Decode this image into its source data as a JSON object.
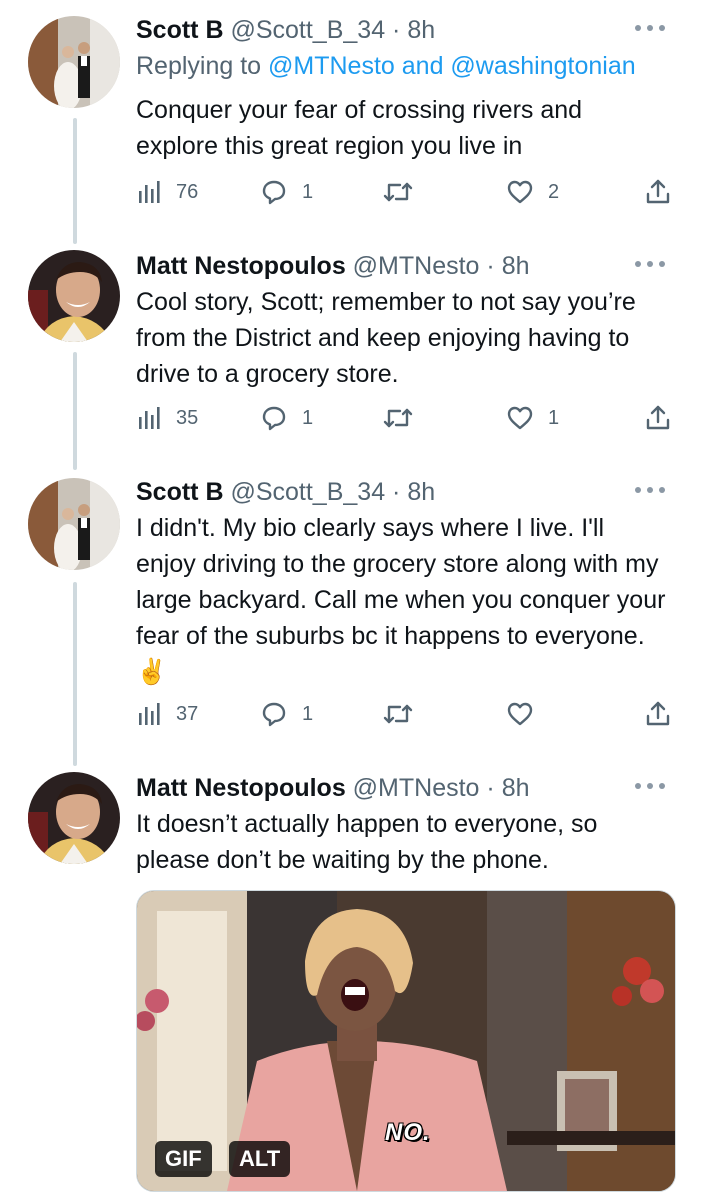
{
  "tweets": [
    {
      "name": "Scott B",
      "handle": "@Scott_B_34",
      "time": "· 8h",
      "replying_prefix": "Replying to",
      "replying_handles": "@MTNesto and @washingtonian",
      "text": "Conquer your fear of crossing rivers and explore this great region you live in",
      "views": "76",
      "replies": "1",
      "retweets": "",
      "likes": "2"
    },
    {
      "name": "Matt Nestopoulos",
      "handle": "@MTNesto",
      "time": "· 8h",
      "text": "Cool story, Scott; remember to not say you’re from the District and keep enjoying having to drive to a grocery store.",
      "views": "35",
      "replies": "1",
      "retweets": "",
      "likes": "1"
    },
    {
      "name": "Scott B",
      "handle": "@Scott_B_34",
      "time": "· 8h",
      "text": "I didn't. My bio clearly says where I live. I'll enjoy driving to the grocery store along with my large backyard. Call me when you conquer your fear of the suburbs bc it happens to everyone. ✌️",
      "views": "37",
      "replies": "1",
      "retweets": "",
      "likes": ""
    },
    {
      "name": "Matt Nestopoulos",
      "handle": "@MTNesto",
      "time": "· 8h",
      "text": "It doesn’t actually happen to everyone, so please don’t be waiting by the phone."
    }
  ],
  "media": {
    "gif_badge": "GIF",
    "alt_badge": "ALT",
    "caption": "NO."
  },
  "icons": {
    "views": "bar-chart-icon",
    "reply": "reply-bubble-icon",
    "retweet": "retweet-icon",
    "like": "heart-icon",
    "share": "share-icon",
    "more": "more-dots-icon"
  },
  "colors": {
    "link": "#1d9bf0",
    "secondary_text": "#536471",
    "thread_line": "#cfd9de"
  }
}
